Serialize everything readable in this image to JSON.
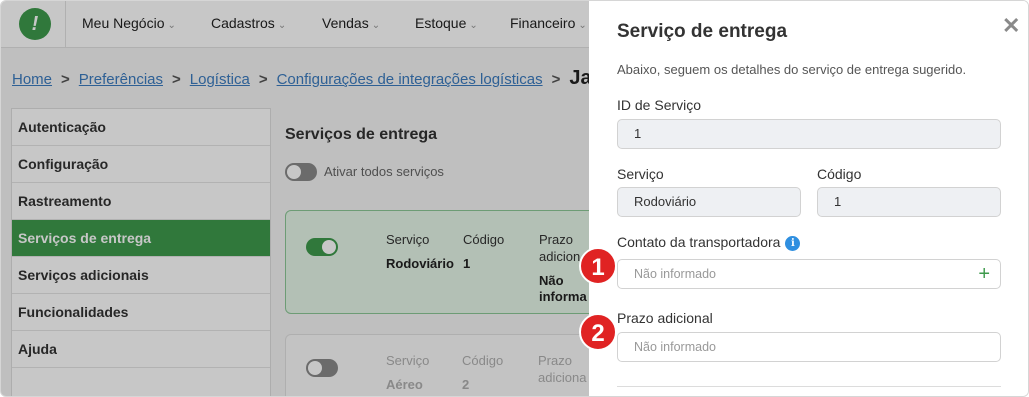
{
  "nav": {
    "logo_glyph": "!",
    "items": [
      {
        "label": "Meu Negócio"
      },
      {
        "label": "Cadastros"
      },
      {
        "label": "Vendas"
      },
      {
        "label": "Estoque"
      },
      {
        "label": "Financeiro"
      }
    ],
    "chevron": "⌄"
  },
  "breadcrumb": {
    "items": [
      "Home",
      "Preferências",
      "Logística",
      "Configurações de integrações logísticas"
    ],
    "separator": ">",
    "current": "Ja"
  },
  "sidebar": {
    "items": [
      {
        "label": "Autenticação"
      },
      {
        "label": "Configuração"
      },
      {
        "label": "Rastreamento"
      },
      {
        "label": "Serviços de entrega",
        "active": true
      },
      {
        "label": "Serviços adicionais"
      },
      {
        "label": "Funcionalidades"
      },
      {
        "label": "Ajuda"
      }
    ]
  },
  "main": {
    "title": "Serviços de entrega",
    "toggle_all_label": "Ativar todos serviços",
    "cards": [
      {
        "enabled": true,
        "service_label": "Serviço",
        "service_value": "Rodoviário",
        "code_label": "Código",
        "code_value": "1",
        "prazo_label_1": "Prazo",
        "prazo_label_2": "adicion",
        "prazo_value_1": "Não",
        "prazo_value_2": "informa"
      },
      {
        "enabled": false,
        "service_label": "Serviço",
        "service_value": "Aéreo",
        "code_label": "Código",
        "code_value": "2",
        "prazo_label_1": "Prazo",
        "prazo_label_2": "adiciona"
      }
    ]
  },
  "drawer": {
    "title": "Serviço de entrega",
    "close_glyph": "✕",
    "subtitle": "Abaixo, seguem os detalhes do serviço de entrega sugerido.",
    "service_id_label": "ID de Serviço",
    "service_id_value": "1",
    "service_label": "Serviço",
    "service_value": "Rodoviário",
    "code_label": "Código",
    "code_value": "1",
    "contact_label": "Contato da transportadora",
    "info_glyph": "i",
    "contact_placeholder": "Não informado",
    "add_glyph": "+",
    "prazo_label": "Prazo adicional",
    "prazo_placeholder": "Não informado"
  },
  "annotations": {
    "badge_1": "1",
    "badge_2": "2"
  },
  "colors": {
    "brand_green": "#3e9a4c",
    "link_blue": "#3b7bbf",
    "badge_red": "#e02323",
    "info_blue": "#2f8fe0"
  }
}
